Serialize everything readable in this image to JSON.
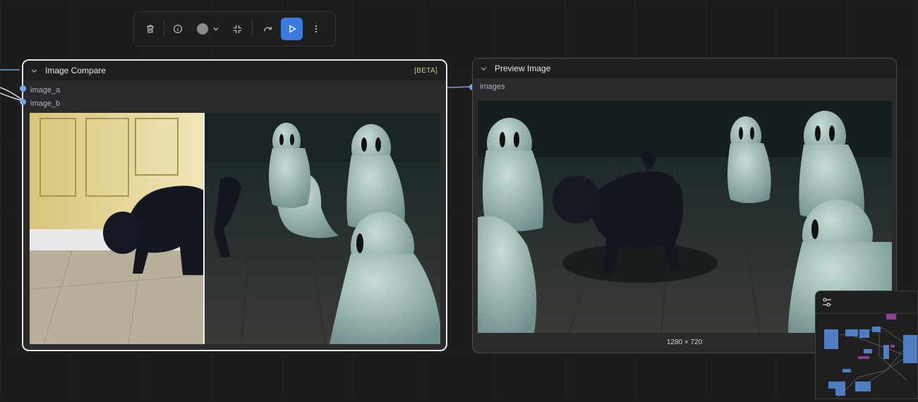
{
  "toolbar": {
    "buttons": [
      {
        "name": "delete",
        "icon": "trash-icon"
      },
      {
        "name": "info",
        "icon": "info-icon"
      },
      {
        "name": "color",
        "icon": "color-dot-icon",
        "color": "#8a8a8a"
      },
      {
        "name": "collapse",
        "icon": "minimize-icon"
      },
      {
        "name": "bypass",
        "icon": "redo-icon"
      },
      {
        "name": "run",
        "icon": "play-icon"
      },
      {
        "name": "more",
        "icon": "more-vertical-icon"
      }
    ],
    "accent": "#3b7be0"
  },
  "nodes": {
    "image_compare": {
      "title": "Image Compare",
      "badge": "[BETA]",
      "inputs": [
        "image_a",
        "image_b"
      ]
    },
    "preview_image": {
      "title": "Preview Image",
      "inputs": [
        "images"
      ],
      "dimensions": "1280 × 720"
    }
  },
  "colors": {
    "link": "#6f9fe0",
    "slot": "#7aa6e6",
    "selected_border": "#e6e6e6",
    "badge": "#b9d28a"
  }
}
